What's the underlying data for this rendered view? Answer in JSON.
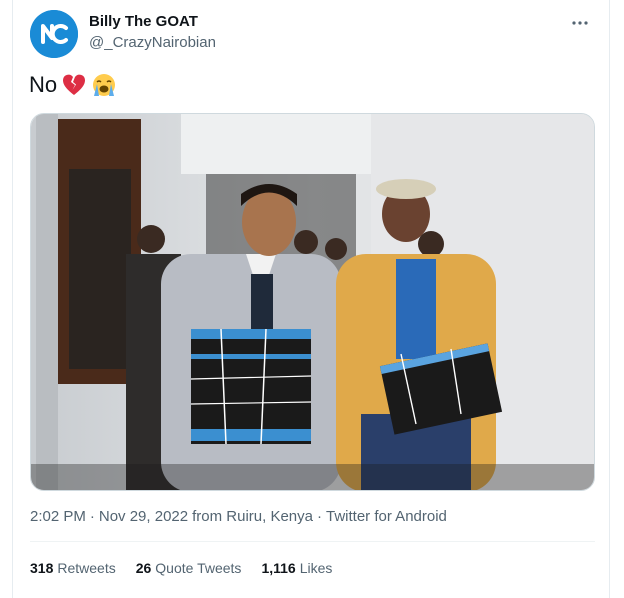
{
  "user": {
    "name": "Billy The GOAT",
    "handle": "@_CrazyNairobian"
  },
  "tweet": {
    "text": "No",
    "emojis": [
      "broken-heart-emoji",
      "loudly-crying-face-emoji"
    ]
  },
  "meta": {
    "time": "2:02 PM",
    "sep1": "·",
    "date": "Nov 29, 2022",
    "location": "from Ruiru, Kenya",
    "sep2": "·",
    "client": "Twitter for Android"
  },
  "stats": {
    "retweets_count": "318",
    "retweets_label": "Retweets",
    "quotes_count": "26",
    "quotes_label": "Quote Tweets",
    "likes_count": "1,116",
    "likes_label": "Likes"
  },
  "colors": {
    "avatar_bg": "#1a8bd6",
    "secondary_text": "#536471",
    "border": "#cfd9de"
  },
  "icons": {
    "more": "more-horizontal-icon",
    "avatar": "brand-logo-avatar"
  }
}
